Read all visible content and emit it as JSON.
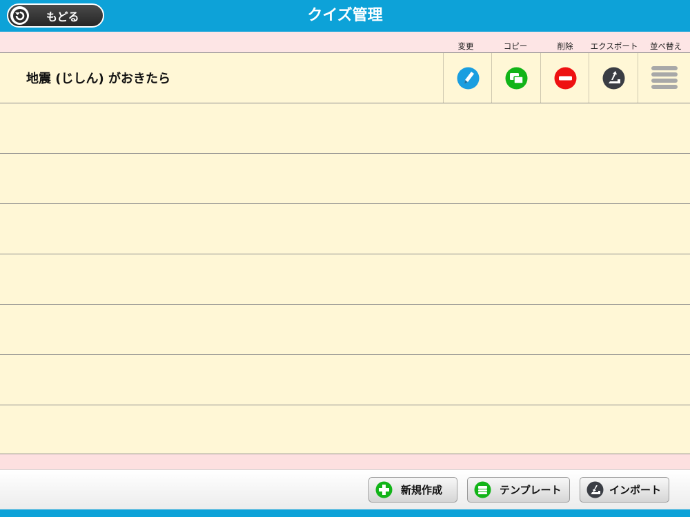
{
  "header": {
    "back_label": "もどる",
    "title": "クイズ管理"
  },
  "columns": {
    "edit": "変更",
    "copy": "コピー",
    "delete": "削除",
    "export": "エクスポート",
    "reorder": "並べ替え"
  },
  "quizzes": [
    {
      "title": "地震 (じしん) がおきたら"
    }
  ],
  "toolbar": {
    "new_label": "新規作成",
    "template_label": "テンプレート",
    "import_label": "インポート"
  },
  "colors": {
    "header_blue": "#0da2d8",
    "row_bg": "#fff7d6",
    "column_header_bg": "#fde5e5",
    "edit_blue": "#1a9ee0",
    "copy_green": "#12b418",
    "delete_red": "#ee1111",
    "export_dark": "#3a3d44"
  },
  "icons": {
    "back": "back-arrow-icon",
    "edit": "pencil-icon",
    "copy": "copy-icon",
    "delete": "minus-icon",
    "export": "export-icon",
    "reorder": "drag-handle-icon",
    "new": "plus-icon",
    "template": "template-icon",
    "import": "import-icon"
  }
}
